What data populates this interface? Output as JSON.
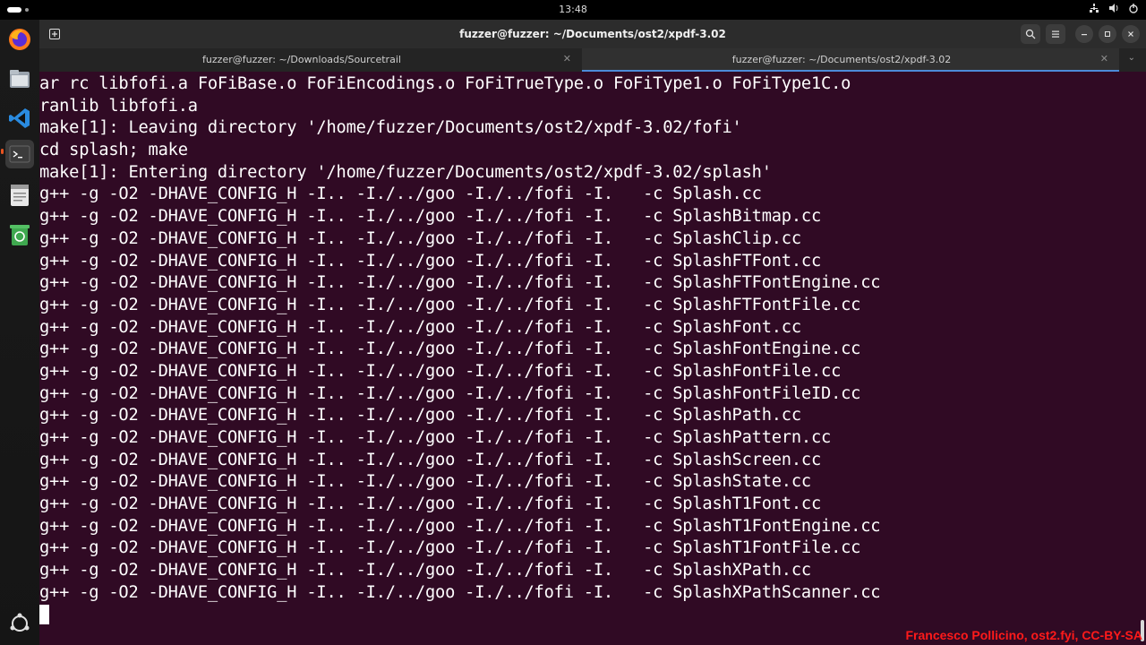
{
  "topbar": {
    "clock": "13:48"
  },
  "window": {
    "title": "fuzzer@fuzzer: ~/Documents/ost2/xpdf-3.02"
  },
  "tabs": [
    {
      "label": "fuzzer@fuzzer: ~/Downloads/Sourcetrail",
      "active": false
    },
    {
      "label": "fuzzer@fuzzer: ~/Documents/ost2/xpdf-3.02",
      "active": true
    }
  ],
  "terminal": {
    "lines": [
      "ar rc libfofi.a FoFiBase.o FoFiEncodings.o FoFiTrueType.o FoFiType1.o FoFiType1C.o",
      "ranlib libfofi.a",
      "make[1]: Leaving directory '/home/fuzzer/Documents/ost2/xpdf-3.02/fofi'",
      "cd splash; make",
      "make[1]: Entering directory '/home/fuzzer/Documents/ost2/xpdf-3.02/splash'",
      "g++ -g -O2 -DHAVE_CONFIG_H -I.. -I./../goo -I./../fofi -I.   -c Splash.cc",
      "g++ -g -O2 -DHAVE_CONFIG_H -I.. -I./../goo -I./../fofi -I.   -c SplashBitmap.cc",
      "g++ -g -O2 -DHAVE_CONFIG_H -I.. -I./../goo -I./../fofi -I.   -c SplashClip.cc",
      "g++ -g -O2 -DHAVE_CONFIG_H -I.. -I./../goo -I./../fofi -I.   -c SplashFTFont.cc",
      "g++ -g -O2 -DHAVE_CONFIG_H -I.. -I./../goo -I./../fofi -I.   -c SplashFTFontEngine.cc",
      "g++ -g -O2 -DHAVE_CONFIG_H -I.. -I./../goo -I./../fofi -I.   -c SplashFTFontFile.cc",
      "g++ -g -O2 -DHAVE_CONFIG_H -I.. -I./../goo -I./../fofi -I.   -c SplashFont.cc",
      "g++ -g -O2 -DHAVE_CONFIG_H -I.. -I./../goo -I./../fofi -I.   -c SplashFontEngine.cc",
      "g++ -g -O2 -DHAVE_CONFIG_H -I.. -I./../goo -I./../fofi -I.   -c SplashFontFile.cc",
      "g++ -g -O2 -DHAVE_CONFIG_H -I.. -I./../goo -I./../fofi -I.   -c SplashFontFileID.cc",
      "g++ -g -O2 -DHAVE_CONFIG_H -I.. -I./../goo -I./../fofi -I.   -c SplashPath.cc",
      "g++ -g -O2 -DHAVE_CONFIG_H -I.. -I./../goo -I./../fofi -I.   -c SplashPattern.cc",
      "g++ -g -O2 -DHAVE_CONFIG_H -I.. -I./../goo -I./../fofi -I.   -c SplashScreen.cc",
      "g++ -g -O2 -DHAVE_CONFIG_H -I.. -I./../goo -I./../fofi -I.   -c SplashState.cc",
      "g++ -g -O2 -DHAVE_CONFIG_H -I.. -I./../goo -I./../fofi -I.   -c SplashT1Font.cc",
      "g++ -g -O2 -DHAVE_CONFIG_H -I.. -I./../goo -I./../fofi -I.   -c SplashT1FontEngine.cc",
      "g++ -g -O2 -DHAVE_CONFIG_H -I.. -I./../goo -I./../fofi -I.   -c SplashT1FontFile.cc",
      "g++ -g -O2 -DHAVE_CONFIG_H -I.. -I./../goo -I./../fofi -I.   -c SplashXPath.cc",
      "g++ -g -O2 -DHAVE_CONFIG_H -I.. -I./../goo -I./../fofi -I.   -c SplashXPathScanner.cc"
    ]
  },
  "dock": {
    "items": [
      {
        "name": "firefox-icon"
      },
      {
        "name": "files-icon"
      },
      {
        "name": "vscode-icon"
      },
      {
        "name": "terminal-icon"
      },
      {
        "name": "text-editor-icon"
      },
      {
        "name": "trash-icon"
      },
      {
        "name": "show-apps-icon"
      }
    ]
  },
  "watermark": "Francesco Pollicino, ost2.fyi, CC-BY-SA",
  "colors": {
    "terminal_bg": "#300a24",
    "accent": "#e95420",
    "tab_active_underline": "#4c8bd9"
  }
}
